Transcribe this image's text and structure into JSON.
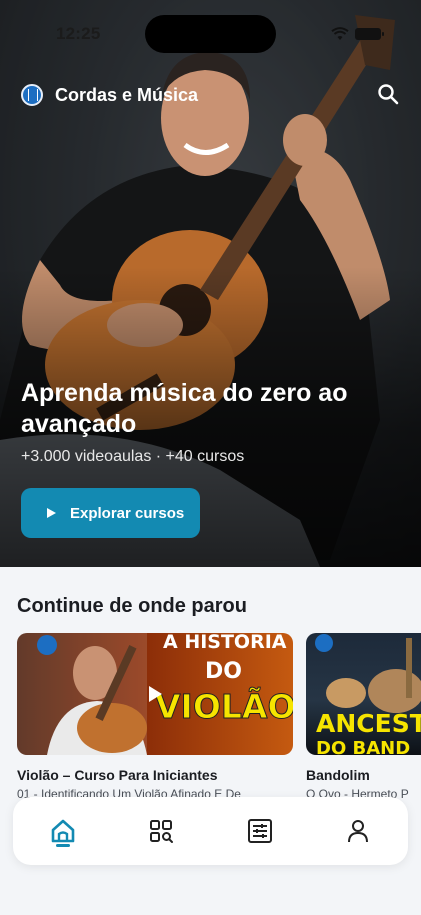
{
  "status": {
    "time": "12:25"
  },
  "app": {
    "title": "Cordas e Música"
  },
  "hero": {
    "title": "Aprenda música do zero ao avançado",
    "subtitle": "+3.000 videoaulas · +40 cursos",
    "cta_label": "Explorar cursos"
  },
  "continue_section": {
    "title": "Continue de onde parou",
    "cards": [
      {
        "title": "Violão – Curso Para Iniciantes",
        "subtitle": "01 - Identificando Um Violão Afinado E De",
        "thumb_text_1": "A HISTÓRIA",
        "thumb_text_2": "DO",
        "thumb_text_3": "VIOLÃO",
        "thumb_brand": "Cordas e Música"
      },
      {
        "title": "Bandolim",
        "subtitle": "O Ovo - Hermeto P",
        "thumb_text_1": "ANCESTRA",
        "thumb_text_2": "DO BAND",
        "thumb_brand": "Cordas e Música"
      }
    ]
  },
  "tabbar": {
    "items": [
      "home-icon",
      "catalog-search-icon",
      "list-settings-icon",
      "profile-icon"
    ],
    "active": 0
  },
  "colors": {
    "accent": "#138ab2",
    "background": "#f3f5f8"
  }
}
